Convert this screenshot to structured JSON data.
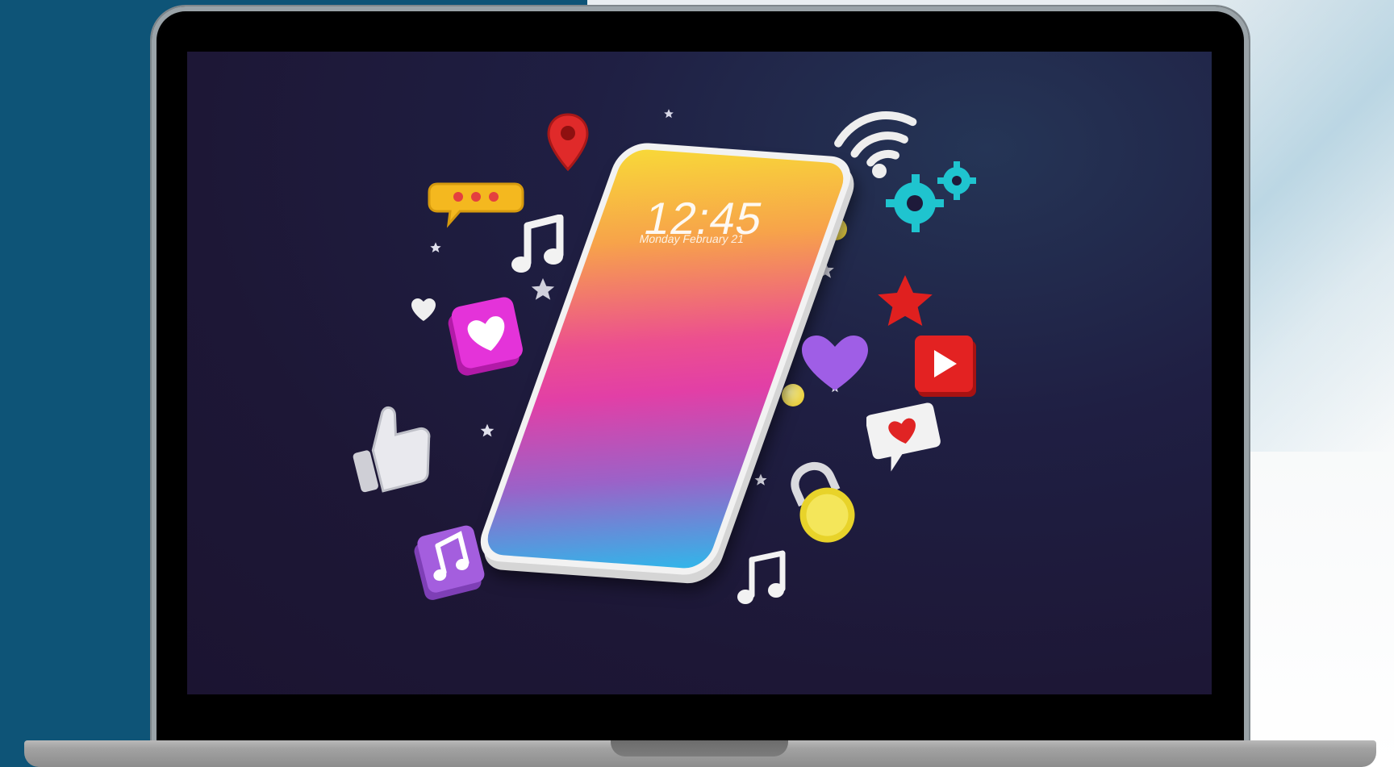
{
  "lock_screen": {
    "time": "12:45",
    "date": "Monday February 21"
  },
  "colors": {
    "left_background": "#0e5477",
    "screen_background": "#1d1736",
    "laptop_frame": "#030303",
    "laptop_base": "#a2a2a2"
  },
  "icons": [
    "location-pin-icon",
    "chat-bubble-icon",
    "music-note-icon",
    "heart-icon",
    "heart-box-icon",
    "thumbs-up-icon",
    "music-box-icon",
    "wifi-icon",
    "gear-icon",
    "star-icon",
    "play-button-icon",
    "heart-chat-icon",
    "padlock-icon"
  ]
}
